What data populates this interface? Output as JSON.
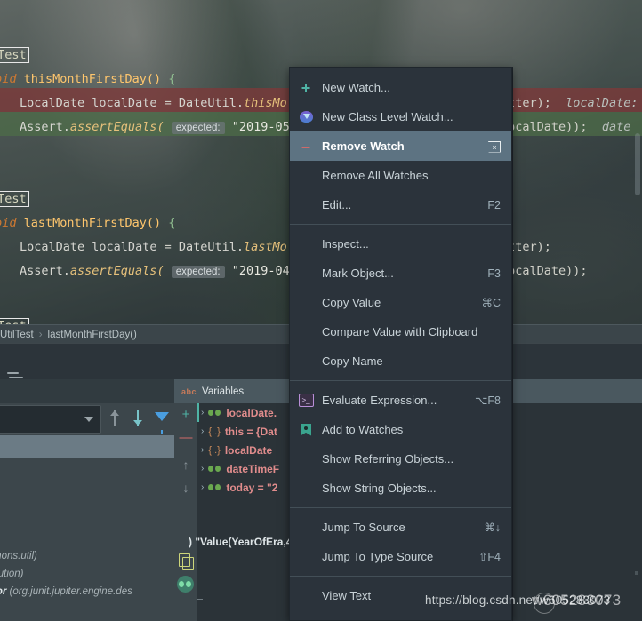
{
  "editor": {
    "lines": [
      {
        "annotation": "@Test"
      },
      {
        "signature_kw": "void",
        "method": "thisMonthFirstDay()",
        "open": "{"
      },
      {
        "type": "LocalDate",
        "var": "localDate",
        "eq": "=",
        "call": "DateUtil.",
        "member": "thisMo",
        "tail": "atter);",
        "tail_italic": "localDate:"
      },
      {
        "assert": "Assert.",
        "method": "assertEquals(",
        "hint": "expected:",
        "value": "\"2019-05",
        "tail": "localDate));",
        "tail_italic": "date"
      },
      {
        "close": "}"
      },
      {
        "annotation": "@Test"
      },
      {
        "signature_kw": "void",
        "method": "lastMonthFirstDay()",
        "open": "{"
      },
      {
        "type": "LocalDate",
        "var": "localDate",
        "eq": "=",
        "call": "DateUtil.",
        "member": "lastMo",
        "tail": "atter);"
      },
      {
        "assert": "Assert.",
        "method": "assertEquals(",
        "hint": "expected:",
        "value": "\"2019-04",
        "tail": "localDate));"
      },
      {
        "close": "}"
      }
    ]
  },
  "breadcrumb": {
    "class": "UtilTest",
    "separator": "›",
    "method": "lastMonthFirstDay()"
  },
  "debugger": {
    "frames": {
      "combo_value": "",
      "icons": [
        "arrow-up-icon",
        "arrow-down-icon",
        "filter-icon"
      ]
    },
    "variables": {
      "title": "Variables",
      "type_icon": "abc",
      "side_buttons": [
        "+",
        "—",
        "↑",
        "↓"
      ],
      "rows": [
        {
          "chevron": "›",
          "icon": "watch-icon",
          "text": "localDate."
        },
        {
          "chevron": "›",
          "icon": "object-icon",
          "text": "this = {Dat"
        },
        {
          "chevron": "›",
          "icon": "object-icon",
          "text": "localDate"
        },
        {
          "chevron": "›",
          "icon": "watch-icon",
          "text": "dateTimeF"
        },
        {
          "chevron": "›",
          "icon": "watch-icon",
          "text": "today = \"2"
        }
      ]
    },
    "console_left": [
      "mons.util)",
      "cution)",
      "tor"
    ],
    "console_left_italic_tail": " (org.junit.jupiter.engine.des",
    "console_right": ") \"Value(YearOfEra,4,"
  },
  "context_menu": {
    "items": [
      {
        "label": "New Watch...",
        "shortcut": "",
        "icon": "plus-icon",
        "selected": false,
        "separator_after": false
      },
      {
        "label": "New Class Level Watch...",
        "shortcut": "",
        "icon": "class-watch-icon",
        "selected": false,
        "separator_after": false
      },
      {
        "label": "Remove Watch",
        "shortcut": "delete-key",
        "icon": "minus-icon",
        "selected": true,
        "separator_after": false
      },
      {
        "label": "Remove All Watches",
        "shortcut": "",
        "icon": "",
        "selected": false,
        "separator_after": false
      },
      {
        "label": "Edit...",
        "shortcut": "F2",
        "icon": "",
        "selected": false,
        "separator_after": true
      },
      {
        "label": "Inspect...",
        "shortcut": "",
        "icon": "",
        "selected": false,
        "separator_after": false
      },
      {
        "label": "Mark Object...",
        "shortcut": "F3",
        "icon": "",
        "selected": false,
        "separator_after": false
      },
      {
        "label": "Copy Value",
        "shortcut": "⌘C",
        "icon": "",
        "selected": false,
        "separator_after": false
      },
      {
        "label": "Compare Value with Clipboard",
        "shortcut": "",
        "icon": "",
        "selected": false,
        "separator_after": false
      },
      {
        "label": "Copy Name",
        "shortcut": "",
        "icon": "",
        "selected": false,
        "separator_after": true
      },
      {
        "label": "Evaluate Expression...",
        "shortcut": "⌥F8",
        "icon": "evaluate-icon",
        "selected": false,
        "separator_after": false
      },
      {
        "label": "Add to Watches",
        "shortcut": "",
        "icon": "bookmark-icon",
        "selected": false,
        "separator_after": false
      },
      {
        "label": "Show Referring Objects...",
        "shortcut": "",
        "icon": "",
        "selected": false,
        "separator_after": false
      },
      {
        "label": "Show String Objects...",
        "shortcut": "",
        "icon": "",
        "selected": false,
        "separator_after": true
      },
      {
        "label": "Jump To Source",
        "shortcut": "⌘↓",
        "icon": "",
        "selected": false,
        "separator_after": false
      },
      {
        "label": "Jump To Type Source",
        "shortcut": "⇧F4",
        "icon": "",
        "selected": false,
        "separator_after": true
      },
      {
        "label": "View Text",
        "shortcut": "",
        "icon": "",
        "selected": false,
        "separator_after": false
      }
    ]
  },
  "watermark": {
    "url": "https://blog.csdn.net/w605283073",
    "overlay": "w605283073"
  },
  "colors": {
    "menu_bg": "#2b333b",
    "menu_selected": "#5d7382",
    "accent_teal": "#4fb3a5",
    "accent_red": "#cf6a6a",
    "var_name": "#e08c8c",
    "vars_header": "#4a585f"
  }
}
